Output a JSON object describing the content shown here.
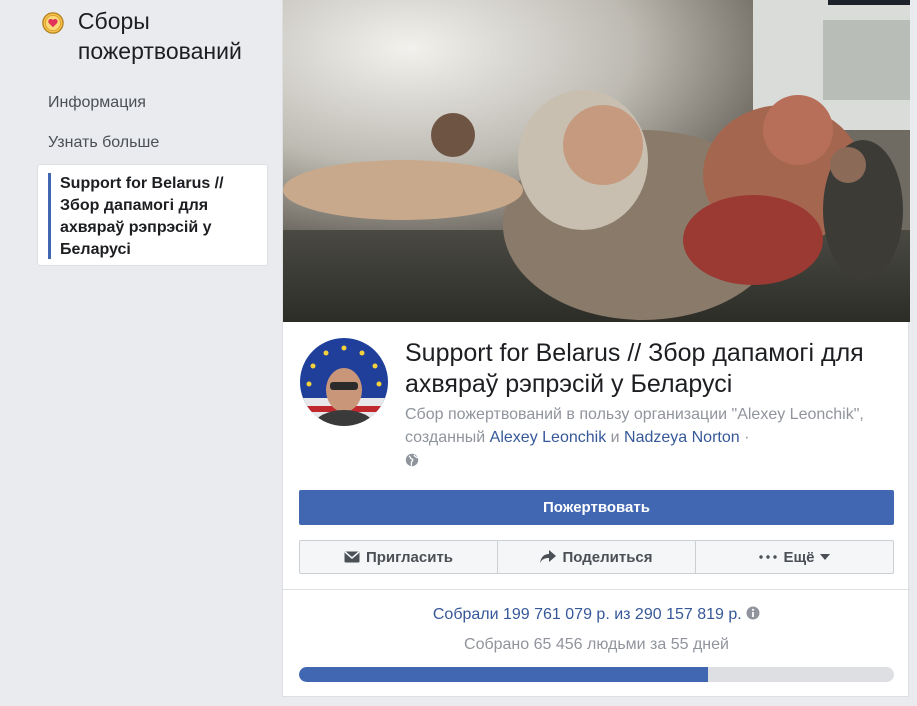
{
  "sidebar": {
    "app_title": "Сборы пожертвований",
    "items": [
      {
        "label": "Информация"
      },
      {
        "label": "Узнать больше"
      },
      {
        "label": "Support for Belarus // Збор дапамогі для ахвяраў рэпрэсій у Беларусі"
      }
    ]
  },
  "fundraiser": {
    "title": "Support for Belarus // Збор дапамогі для ахвяраў рэпрэсій у Беларусі",
    "subtitle_prefix": "Сбор пожертвований в пользу организации \"Alexey Leonchik\", созданный ",
    "creator1": "Alexey Leonchik",
    "and": " и ",
    "creator2": "Nadzeya Norton",
    "dot": " ·",
    "donate_label": "Пожертвовать",
    "actions": {
      "invite": "Пригласить",
      "share": "Поделиться",
      "more": "Ещё"
    },
    "raised_text": "Собрали 199 761 079 р. из 290 157 819 р.",
    "count_text": "Собрано 65 456 людьми за 55 дней",
    "progress": 0.688
  },
  "colors": {
    "accent": "#4267b2",
    "link": "#365899",
    "muted": "#90949c"
  },
  "icons": [
    "heart-coin-icon",
    "globe-icon",
    "envelope-icon",
    "share-arrow-icon",
    "dots-icon",
    "caret-down-icon",
    "info-icon"
  ]
}
